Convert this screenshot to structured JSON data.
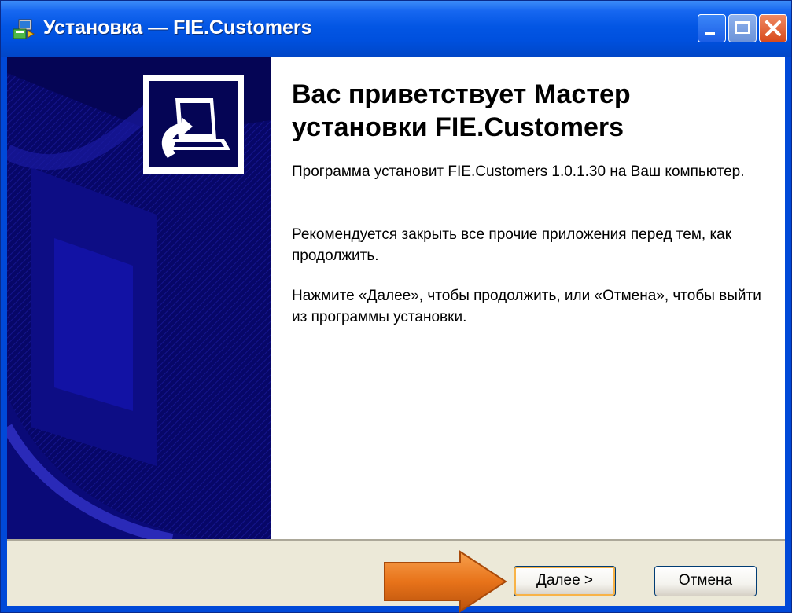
{
  "window": {
    "title": "Установка — FIE.Customers"
  },
  "content": {
    "heading": "Вас приветствует Мастер установки FIE.Customers",
    "paragraph1": "Программа установит FIE.Customers 1.0.1.30 на Ваш компьютер.",
    "paragraph2": "Рекомендуется закрыть все прочие приложения перед тем, как продолжить.",
    "paragraph3": "Нажмите «Далее», чтобы продолжить, или «Отмена», чтобы выйти из программы установки."
  },
  "buttons": {
    "next_hotkey": "Д",
    "next_rest": "алее >",
    "cancel": "Отмена"
  },
  "icons": {
    "window": "installer-icon",
    "wizard": "computer-install-icon",
    "annotation": "orange-arrow-pointer"
  },
  "colors": {
    "titlebar": "#0356e4",
    "banner": "#050555",
    "arrow": "#e8731a"
  }
}
